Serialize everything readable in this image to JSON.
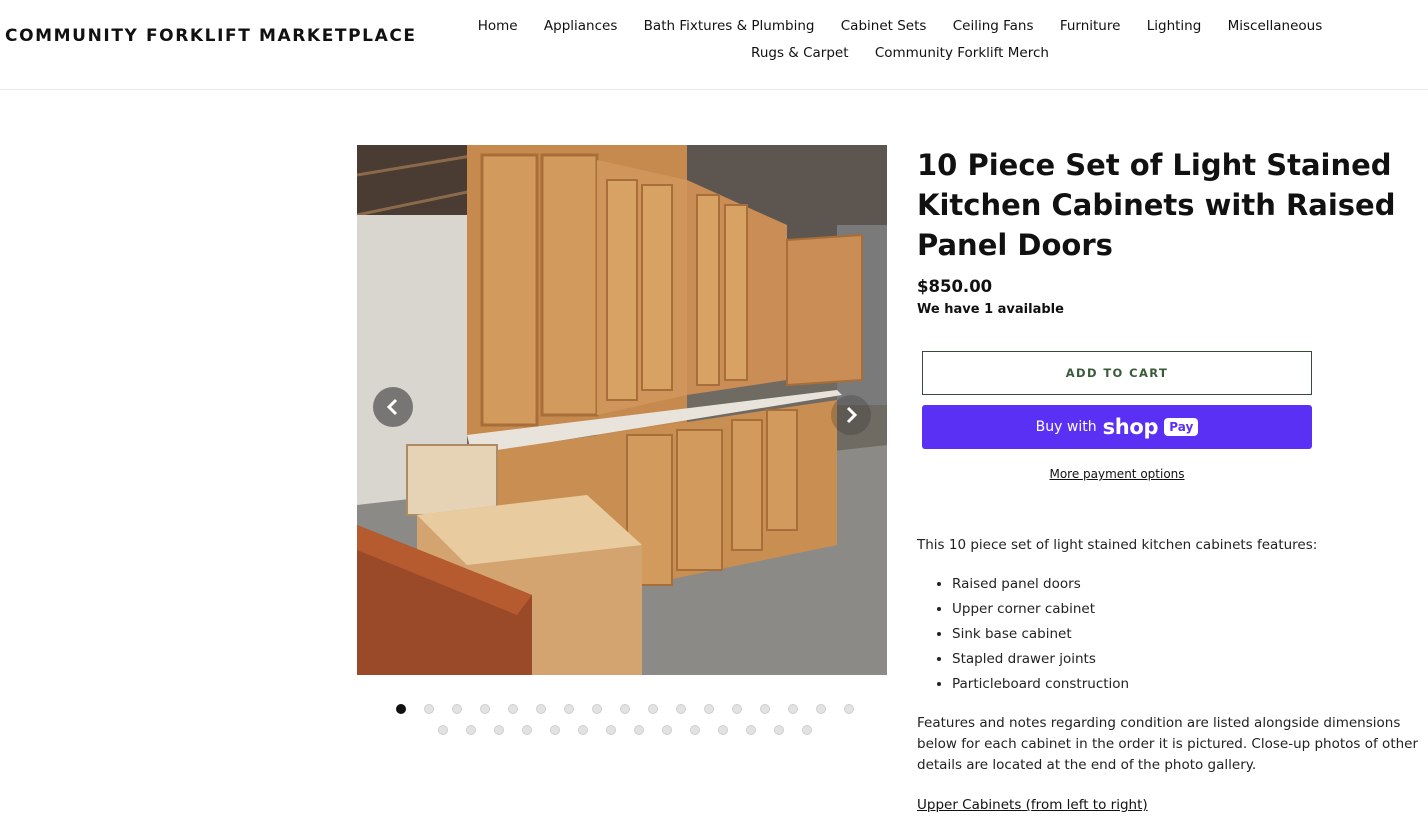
{
  "header": {
    "store_name": "COMMUNITY FORKLIFT MARKETPLACE",
    "nav": [
      "Home",
      "Appliances",
      "Bath Fixtures & Plumbing",
      "Cabinet Sets",
      "Ceiling Fans",
      "Furniture",
      "Lighting",
      "Miscellaneous",
      "Rugs & Carpet",
      "Community Forklift Merch"
    ]
  },
  "gallery": {
    "image_description": "product-photo-kitchen-cabinets",
    "prev_icon": "chevron-left-icon",
    "next_icon": "chevron-right-icon",
    "total_images": 31,
    "active_index": 0
  },
  "product": {
    "title": "10 Piece Set of Light Stained Kitchen Cabinets with Raised Panel Doors",
    "price": "$850.00",
    "availability": "We have 1 available",
    "add_to_cart": "ADD TO CART",
    "buy_with": "Buy with",
    "shop_word": "shop",
    "pay_badge": "Pay",
    "more_payment": "More payment options"
  },
  "description": {
    "intro": "This 10 piece set of light stained kitchen cabinets features:",
    "features": [
      "Raised panel doors",
      "Upper corner cabinet",
      "Sink base cabinet",
      "Stapled drawer joints",
      "Particleboard construction"
    ],
    "notes": "Features and notes regarding condition are listed alongside dimensions below for each cabinet in the order it is pictured. Close-up photos of other details are located at the end of the photo gallery.",
    "section_link": "Upper Cabinets (from left to right)"
  },
  "colors": {
    "shop_pay": "#5a31f4",
    "add_cart_border": "#3a4a3a"
  }
}
